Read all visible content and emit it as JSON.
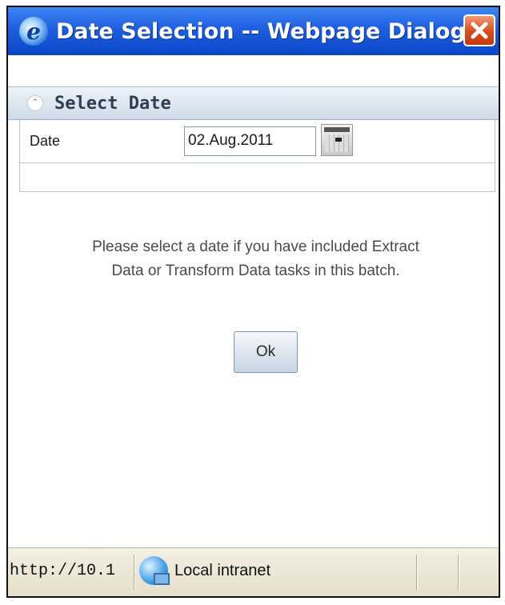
{
  "window": {
    "title": "Date Selection -- Webpage Dialog",
    "close_icon": "close-icon",
    "app_icon": "ie-icon"
  },
  "section": {
    "title": "Select Date",
    "collapse_icon": "chevron-up-icon"
  },
  "form": {
    "date_label": "Date",
    "date_value": "02.Aug.2011",
    "calendar_icon": "calendar-icon"
  },
  "message": {
    "line1": "Please select a date if you have included Extract",
    "line2": "Data or Transform Data tasks in this batch."
  },
  "buttons": {
    "ok_label": "Ok"
  },
  "statusbar": {
    "url": "http://10.1",
    "zone": "Local intranet",
    "zone_icon": "local-intranet-icon"
  },
  "colors": {
    "titlebar": "#0a46c8",
    "close": "#d94a1c",
    "section_header": "#cfdbe8"
  }
}
